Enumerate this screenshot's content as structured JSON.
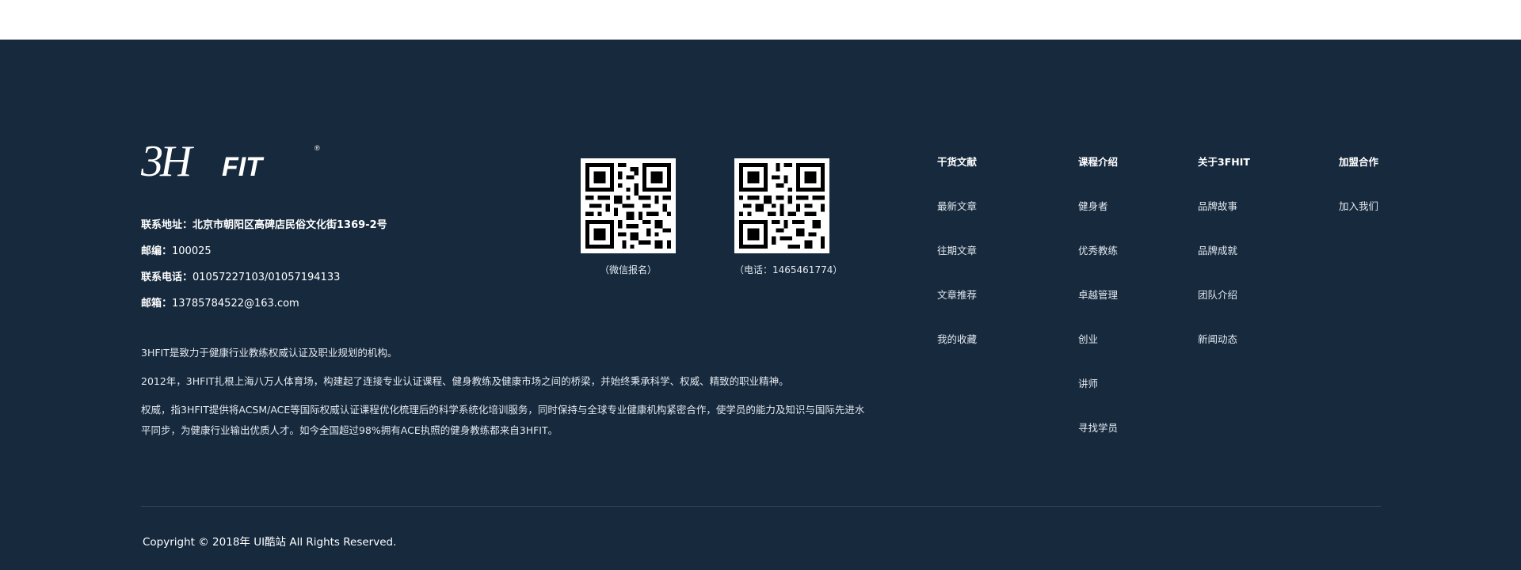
{
  "logo": {
    "text_main": "3H",
    "text_fit": "FIT",
    "reg": "®"
  },
  "contact": {
    "address_label": "联系地址：",
    "address": "北京市朝阳区高碑店民俗文化街1369-2号",
    "zip_label": "邮编：",
    "zip": "100025",
    "phone_label": "联系电话：",
    "phone": "01057227103/01057194133",
    "email_label": "邮箱：",
    "email": "13785784522@163.com"
  },
  "description": {
    "p1": "3HFIT是致力于健康行业教练权威认证及职业规划的机构。",
    "p2": "2012年，3HFIT扎根上海八万人体育场，构建起了连接专业认证课程、健身教练及健康市场之间的桥梁，并始终秉承科学、权威、精致的职业精神。",
    "p3": "权威，指3HFIT提供将ACSM/ACE等国际权威认证课程优化梳理后的科学系统化培训服务，同时保持与全球专业健康机构紧密合作，使学员的能力及知识与国际先进水平同步，为健康行业输出优质人才。如今全国超过98%拥有ACE执照的健身教练都来自3HFIT。"
  },
  "qrcodes": [
    {
      "caption": "（微信报名）"
    },
    {
      "caption": "（电话：1465461774）"
    }
  ],
  "nav": [
    {
      "heading": "干货文献",
      "items": [
        "最新文章",
        "往期文章",
        "文章推荐",
        "我的收藏"
      ]
    },
    {
      "heading": "课程介绍",
      "items": [
        "健身者",
        "优秀教练",
        "卓越管理",
        "创业",
        "讲师",
        "寻找学员"
      ]
    },
    {
      "heading": "关于3FHIT",
      "items": [
        "品牌故事",
        "品牌成就",
        "团队介绍",
        "新闻动态"
      ]
    },
    {
      "heading": "加盟合作",
      "items": [
        "加入我们"
      ]
    }
  ],
  "copyright": "Copyright © 2018年 UI酷站 All Rights Reserved.",
  "colors": {
    "footer_bg": "#16293d",
    "text": "#ffffff",
    "divider": "#33475b"
  }
}
